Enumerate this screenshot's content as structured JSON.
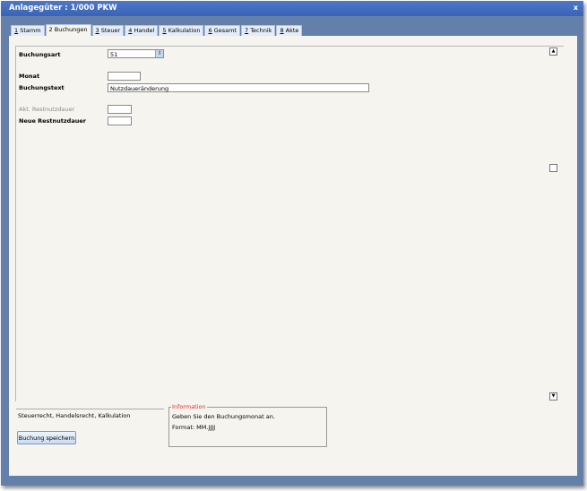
{
  "window": {
    "title": "Anlagegüter : 1/000 PKW",
    "close_label": "x"
  },
  "tabs": [
    {
      "key": "1",
      "label": "Stamm"
    },
    {
      "key": "2",
      "label": "Buchungen",
      "active": true
    },
    {
      "key": "3",
      "label": "Steuer"
    },
    {
      "key": "4",
      "label": "Handel"
    },
    {
      "key": "5",
      "label": "Kalkulation"
    },
    {
      "key": "6",
      "label": "Gesamt"
    },
    {
      "key": "7",
      "label": "Technik"
    },
    {
      "key": "8",
      "label": "Akte"
    }
  ],
  "form": {
    "buchungsart_label": "Buchungsart",
    "buchungsart_value": "51",
    "monat_label": "Monat",
    "monat_value": "",
    "buchungstext_label": "Buchungstext",
    "buchungstext_value": "Nutzdaueränderung",
    "akt_restnutzdauer_label": "Akt. Restnutzdauer",
    "akt_restnutzdauer_value": "",
    "neue_restnutzdauer_label": "Neue Restnutzdauer",
    "neue_restnutzdauer_value": ""
  },
  "footer": {
    "scope_text": "Steuerrecht, Handelsrecht, Kalkulation",
    "info_title": "Information",
    "info_line1": "Geben Sie den Buchungsmonat an.",
    "info_line2": "Format: MM.JJJJ",
    "save_label": "Buchung speichern"
  },
  "colors": {
    "frame": "#6480aa",
    "titlebar": "#3a63b5",
    "info_title": "#e03030"
  }
}
